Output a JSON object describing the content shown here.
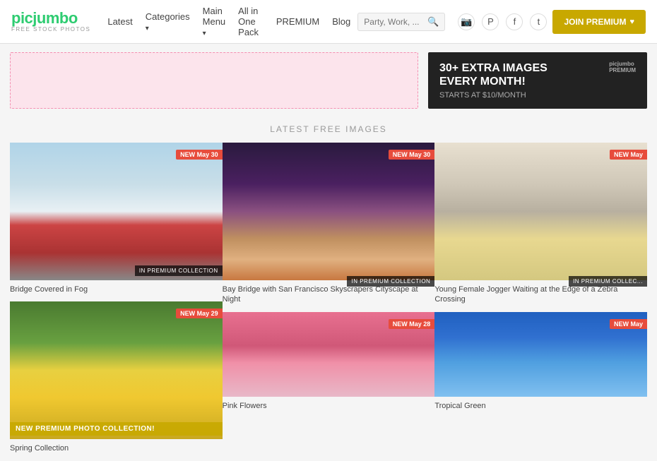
{
  "header": {
    "logo": "picjumbo",
    "logo_sub": "FREE STOCK PHOTOS",
    "nav": {
      "latest": "Latest",
      "categories": "Categories",
      "main_menu": "Main Menu",
      "all_in_one": "All in One Pack",
      "premium": "PREMIUM",
      "blog": "Blog"
    },
    "search_placeholder": "Party, Work, ...",
    "join_button": "JOIN PREMIUM"
  },
  "banner": {
    "right_main": "30+ EXTRA IMAGES",
    "right_sub1": "EVERY MONTH!",
    "right_sub2": "STARTS AT $10/MONTH",
    "right_logo": "picjumbo",
    "right_logo_sub": "PREMIUM"
  },
  "section_title": "LATEST FREE IMAGES",
  "images": {
    "col1": [
      {
        "badge": "NEW May 30",
        "collection": "IN PREMIUM COLLECTION",
        "title": "Bridge Covered in Fog",
        "style": "bridge-fog"
      },
      {
        "badge": "NEW May 29",
        "is_premium_card": true,
        "premium_label": "NEW PREMIUM PHOTO COLLECTION!",
        "title": "Spring Collection",
        "style": "spring-flowers"
      }
    ],
    "col2": [
      {
        "badge": "NEW May 30",
        "collection": "IN PREMIUM COLLECTION",
        "title": "Bay Bridge with San Francisco Skyscrapers Cityscape at Night",
        "style": "bay-bridge"
      },
      {
        "badge": "NEW May 28",
        "title": "Pink Flowers",
        "style": "pink-flowers"
      }
    ],
    "col3": [
      {
        "badge": "NEW May",
        "collection": "IN PREMIUM COLLEC...",
        "title": "Young Female Jogger Waiting at the Edge of a Zebra Crossing",
        "style": "jogger"
      },
      {
        "badge": "NEW May",
        "title": "Tropical Green",
        "style": "green-tropical"
      }
    ]
  }
}
